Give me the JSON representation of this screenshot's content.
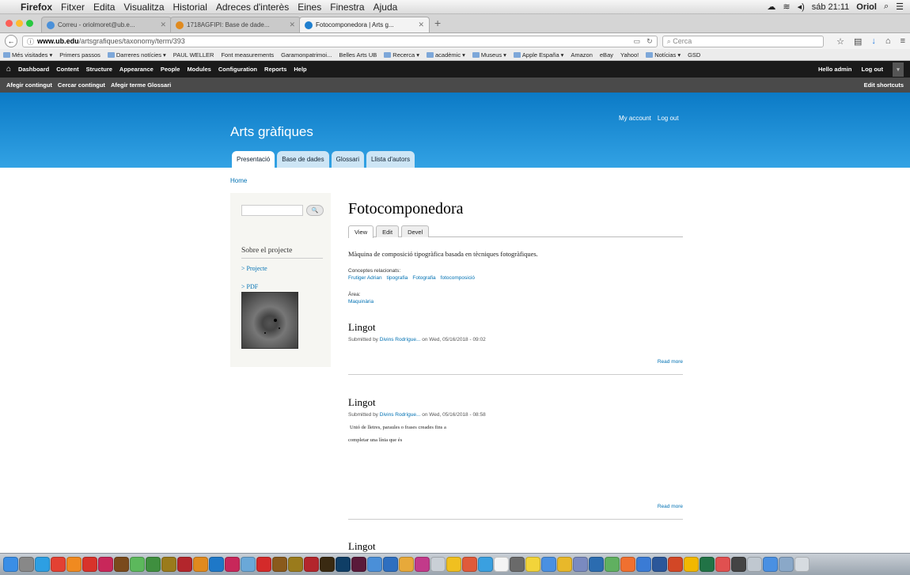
{
  "menubar": {
    "app": "Firefox",
    "items": [
      "Fitxer",
      "Edita",
      "Visualitza",
      "Historial",
      "Adreces d'interès",
      "Eines",
      "Finestra",
      "Ajuda"
    ],
    "clock": "sáb 21:11",
    "user": "Oriol"
  },
  "tabs": [
    {
      "label": "Correu - oriolmoret@ub.e...",
      "color": "#4a90d9"
    },
    {
      "label": "1718AGFIPI: Base de dade...",
      "color": "#e08a1e"
    },
    {
      "label": "Fotocomponedora | Arts g...",
      "color": "#1f7fcf"
    }
  ],
  "url": {
    "domain": "www.ub.edu",
    "path": "/artsgrafiques/taxonomy/term/393"
  },
  "search_placeholder": "Cerca",
  "bookmarks": [
    "Més visitades",
    "Primers passos",
    "Darreres notícies",
    "PAUL WELLER",
    "Font measurements",
    "Garamonpatrimoi...",
    "Belles Arts UB",
    "Recerca",
    "acadèmic",
    "Museus",
    "Apple España",
    "Amazon",
    "eBay",
    "Yahoo!",
    "Notícias",
    "GSD"
  ],
  "admin": {
    "items": [
      "Dashboard",
      "Content",
      "Structure",
      "Appearance",
      "People",
      "Modules",
      "Configuration",
      "Reports",
      "Help"
    ],
    "hello": "Hello admin",
    "logout": "Log out",
    "shortcuts": [
      "Afegir contingut",
      "Cercar contingut",
      "Afegir terme Glossari"
    ],
    "edit_shortcuts": "Edit shortcuts"
  },
  "site": {
    "name": "Arts gràfiques",
    "my_account": "My account",
    "logout": "Log out",
    "primary_tabs": [
      "Presentació",
      "Base de dades",
      "Glossari",
      "Llista d'autors"
    ]
  },
  "breadcrumb": "Home",
  "sidebar": {
    "block_title": "Sobre el projecte",
    "links": [
      "> Projecte",
      "> PDF"
    ]
  },
  "term": {
    "title": "Fotocomponedora",
    "local_tabs": [
      "View",
      "Edit",
      "Devel"
    ],
    "description": "Màquina de composició tipogràfica basada en tècniques fotogràfiques.",
    "related_label": "Conceptes relacionats:",
    "related": [
      "Frutiger Adrian",
      "tipografia",
      "Fotografia",
      "fotocomposició"
    ],
    "area_label": "Àrea:",
    "area": "Maquinària"
  },
  "teasers": [
    {
      "title": "Lingot",
      "submitted": "Submitted by",
      "author": "Divins Rodrígue...",
      "date": "on Wed, 05/16/2018 - 09:02",
      "body": [],
      "readmore": "Read more"
    },
    {
      "title": "Lingot",
      "submitted": "Submitted by",
      "author": "Divins Rodrígue...",
      "date": "on Wed, 05/16/2018 - 08:58",
      "body": [
        "Unió de lletres, paraules o frases creades fins a",
        "completar una línia que és"
      ],
      "readmore": "Read more"
    },
    {
      "title": "Lingot"
    }
  ]
}
